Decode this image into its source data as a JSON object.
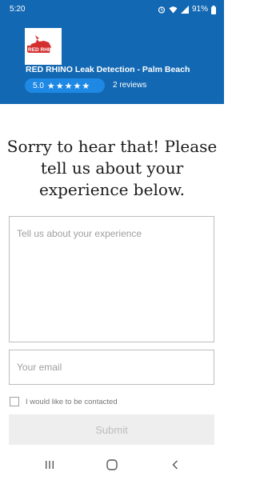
{
  "status_bar": {
    "time": "5:20",
    "battery": "91%",
    "icons": [
      "alarm-icon",
      "wifi-icon",
      "signal-icon",
      "battery-icon"
    ]
  },
  "header": {
    "logo_text": "RED RHINO",
    "business_name": "RED RHINO Leak Detection - Palm Beach",
    "rating": "5.0",
    "stars": "★★★★★",
    "review_count": "2 reviews"
  },
  "feedback": {
    "heading_line1": "Sorry to hear that! Please",
    "heading_line2": "tell us about your",
    "heading_line3": "experience below.",
    "experience_placeholder": "Tell us about your experience",
    "email_placeholder": "Your email",
    "contact_label": "I would like to be contacted",
    "submit_label": "Submit"
  },
  "nav_bar": {
    "buttons": [
      "recent-apps-icon",
      "home-icon",
      "back-icon"
    ]
  },
  "colors": {
    "header_bg": "#1268b3",
    "rating_pill": "#1e88e5",
    "brand_red": "#d32f2f"
  }
}
